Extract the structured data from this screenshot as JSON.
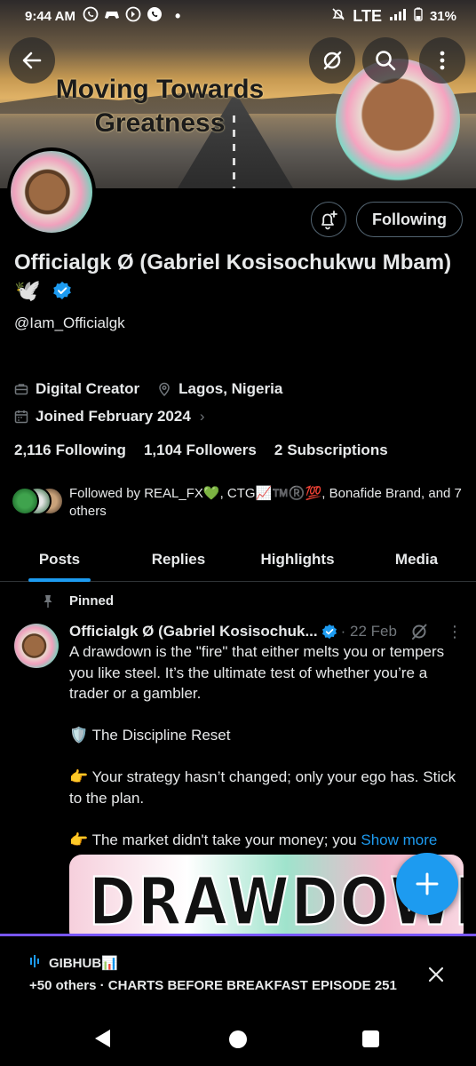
{
  "status_bar": {
    "time": "9:44 AM",
    "network": "LTE",
    "battery": "31%",
    "icons": [
      "whatsapp-icon",
      "gamepad-icon",
      "media-icon",
      "whatsapp-icon",
      "dot"
    ]
  },
  "banner": {
    "title_line1": "Moving Towards",
    "title_line2": "Greatness"
  },
  "top_actions": {
    "back_icon": "arrow-left-icon",
    "grok_icon": "grok-icon",
    "search_icon": "search-icon",
    "more_icon": "more-vertical-icon"
  },
  "profile": {
    "name": "Officialgk Ø (Gabriel Kosisochukwu Mbam) 🕊️",
    "handle": "@Iam_Officialgk",
    "category": "Digital Creator",
    "location": "Lagos, Nigeria",
    "joined": "Joined February 2024",
    "following_count": "2,116",
    "following_label": "Following",
    "followers_count": "1,104",
    "followers_label": "Followers",
    "subscriptions_count": "2",
    "subscriptions_label": "Subscriptions",
    "followed_by": "Followed by REAL_FX💚, CTG📈™️®️💯, Bonafide Brand, and 7 others",
    "follow_button": "Following",
    "accent": "#1d9bf0"
  },
  "tabs": [
    {
      "label": "Posts",
      "active": true
    },
    {
      "label": "Replies",
      "active": false
    },
    {
      "label": "Highlights",
      "active": false
    },
    {
      "label": "Media",
      "active": false
    }
  ],
  "post": {
    "pinned_label": "Pinned",
    "author": "Officialgk Ø (Gabriel Kosisochuk...",
    "date": "· 22 Feb",
    "line1": "A drawdown is the \"fire\" that either melts you or tempers you like steel. It’s the ultimate test of whether you’re a trader or a gambler.",
    "line2": "🛡️ The Discipline Reset",
    "line3": "👉 Your strategy hasn’t changed; only your ego has. Stick to the plan.",
    "line4": "👉 The market didn't take your money; you",
    "show_more": "Show more",
    "image_text": "DRAWDOWN"
  },
  "space": {
    "host": "GIBHUB📊",
    "subtitle": "+50 others · CHARTS BEFORE BREAKFAST EPISODE 251"
  }
}
